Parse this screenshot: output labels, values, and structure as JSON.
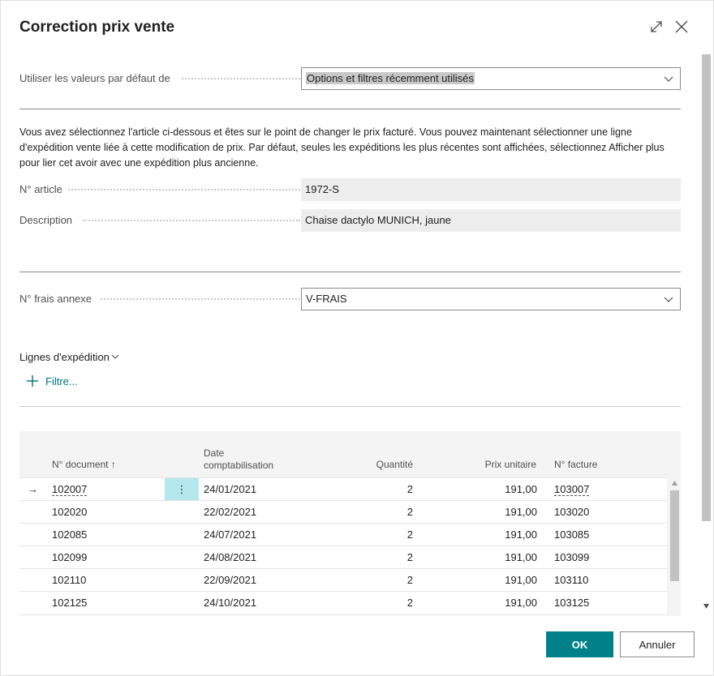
{
  "dialog": {
    "title": "Correction prix vente"
  },
  "defaults": {
    "label": "Utiliser les valeurs par défaut de",
    "value": "Options et filtres récemment utilisés"
  },
  "description": "Vous avez sélectionnez l'article ci-dessous et êtes sur le point de changer le prix facturé. Vous pouvez maintenant sélectionner une ligne d'expédition vente liée à cette modification de prix. Par défaut, seules les expéditions les plus récentes sont affichées, sélectionnez Afficher plus pour lier cet avoir avec une expédition plus ancienne.",
  "fields": {
    "item_no_label": "N° article",
    "item_no_value": "1972-S",
    "description_label": "Description",
    "description_value": "Chaise dactylo MUNICH, jaune",
    "charge_label": "N° frais annexe",
    "charge_value": "V-FRAIS"
  },
  "lines": {
    "title": "Lignes d'expédition",
    "filter_label": "Filtre...",
    "columns": {
      "doc_no": "N° document",
      "sort_indicator": "↑",
      "date_line1": "Date",
      "date_line2": "comptabilisation",
      "qty": "Quantité",
      "unit_price": "Prix unitaire",
      "invoice_no": "N° facture"
    },
    "current_row_indicator": "→",
    "row_menu_glyph": "⋮",
    "rows": [
      {
        "doc": "102007",
        "date": "24/01/2021",
        "qty": "2",
        "price": "191,00",
        "invoice": "103007"
      },
      {
        "doc": "102020",
        "date": "22/02/2021",
        "qty": "2",
        "price": "191,00",
        "invoice": "103020"
      },
      {
        "doc": "102085",
        "date": "24/07/2021",
        "qty": "2",
        "price": "191,00",
        "invoice": "103085"
      },
      {
        "doc": "102099",
        "date": "24/08/2021",
        "qty": "2",
        "price": "191,00",
        "invoice": "103099"
      },
      {
        "doc": "102110",
        "date": "22/09/2021",
        "qty": "2",
        "price": "191,00",
        "invoice": "103110"
      },
      {
        "doc": "102125",
        "date": "24/10/2021",
        "qty": "2",
        "price": "191,00",
        "invoice": "103125"
      }
    ]
  },
  "buttons": {
    "ok": "OK",
    "cancel": "Annuler"
  },
  "icons": {
    "expand": "expand-icon",
    "close": "close-icon",
    "chevron": "chevron-down-icon",
    "plus": "plus-icon",
    "arrow": "arrow-right-icon"
  },
  "colors": {
    "accent": "#00818a",
    "link": "#00707a",
    "row_menu_bg": "#b4e8ee"
  }
}
